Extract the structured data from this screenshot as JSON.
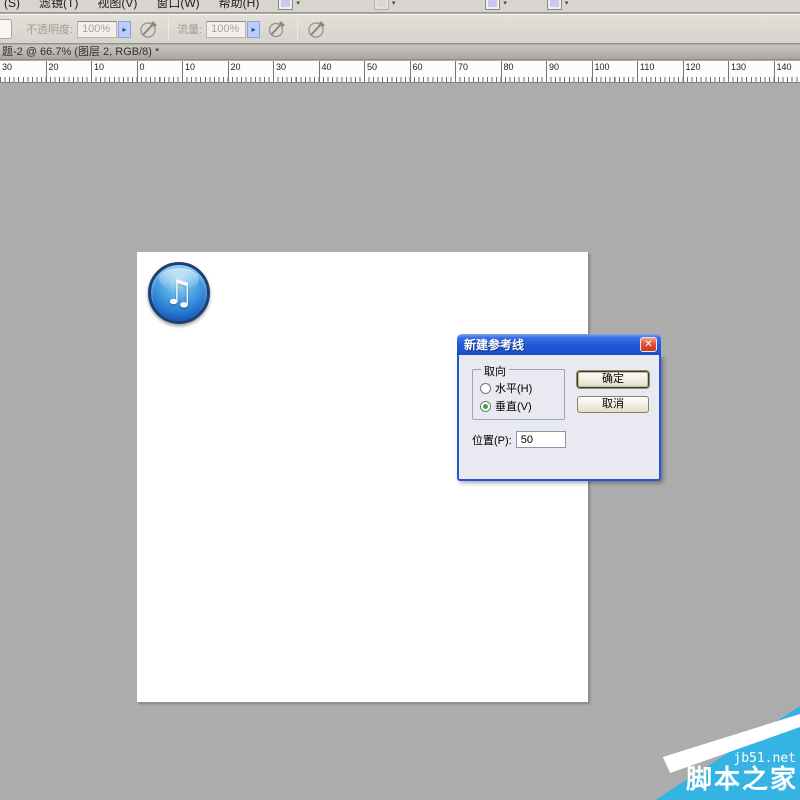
{
  "menu_bar": {
    "items": [
      "(S)",
      "滤镜(T)",
      "视图(V)",
      "窗口(W)",
      "帮助(H)"
    ]
  },
  "options_bar": {
    "opacity_label": "不透明度:",
    "opacity_value": "100%",
    "opacity_arrow": "▸",
    "flow_label": "流量:",
    "flow_value": "100%",
    "flow_arrow": "▸"
  },
  "document_window": {
    "title": "题-2 @ 66.7% (图层 2, RGB/8) *"
  },
  "ruler": {
    "unit_labels": [
      "30",
      "20",
      "10",
      "0",
      "10",
      "20",
      "30",
      "40",
      "50",
      "60",
      "70",
      "80",
      "90",
      "100",
      "110",
      "120",
      "130",
      "140"
    ]
  },
  "canvas": {
    "icon": "itunes-music-note",
    "note_glyph": "♫"
  },
  "dialog": {
    "title": "新建参考线",
    "close_glyph": "✕",
    "orientation_group_label": "取向",
    "radio_horizontal_label": "水平(H)",
    "radio_vertical_label": "垂直(V)",
    "selected_orientation": "vertical",
    "position_label": "位置(P):",
    "position_value": "50",
    "ok_label": "确定",
    "cancel_label": "取消",
    "title_bar_color": "#2258d8",
    "close_button_color": "#e35338"
  },
  "watermark": {
    "site": "jb51.net",
    "brand": "脚本之家",
    "accent_color": "#35b4e4"
  }
}
